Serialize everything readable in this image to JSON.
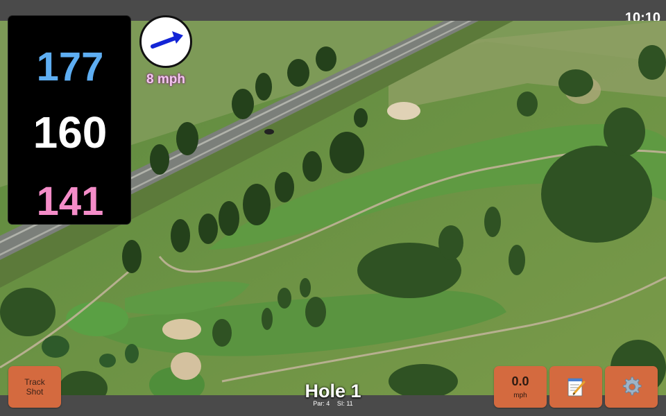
{
  "status": {
    "time": "10:10"
  },
  "distances": {
    "back": "177",
    "middle": "160",
    "front": "141"
  },
  "wind": {
    "speed_label": "8 mph",
    "direction_icon": "arrow-northeast-icon"
  },
  "hole": {
    "title": "Hole 1",
    "par": "Par: 4",
    "stroke_index": "SI: 11"
  },
  "buttons": {
    "track_shot_line1": "Track",
    "track_shot_line2": "Shot",
    "wind_value": "0.0",
    "wind_unit": "mph",
    "notes_icon": "notepad-icon",
    "settings_icon": "gear-icon"
  },
  "colors": {
    "back_distance": "#5eaef2",
    "middle_distance": "#ffffff",
    "front_distance": "#f48cc8",
    "button": "#d46a3f",
    "wind_label": "#f3c7ef",
    "bars": "#4a4a4a"
  }
}
